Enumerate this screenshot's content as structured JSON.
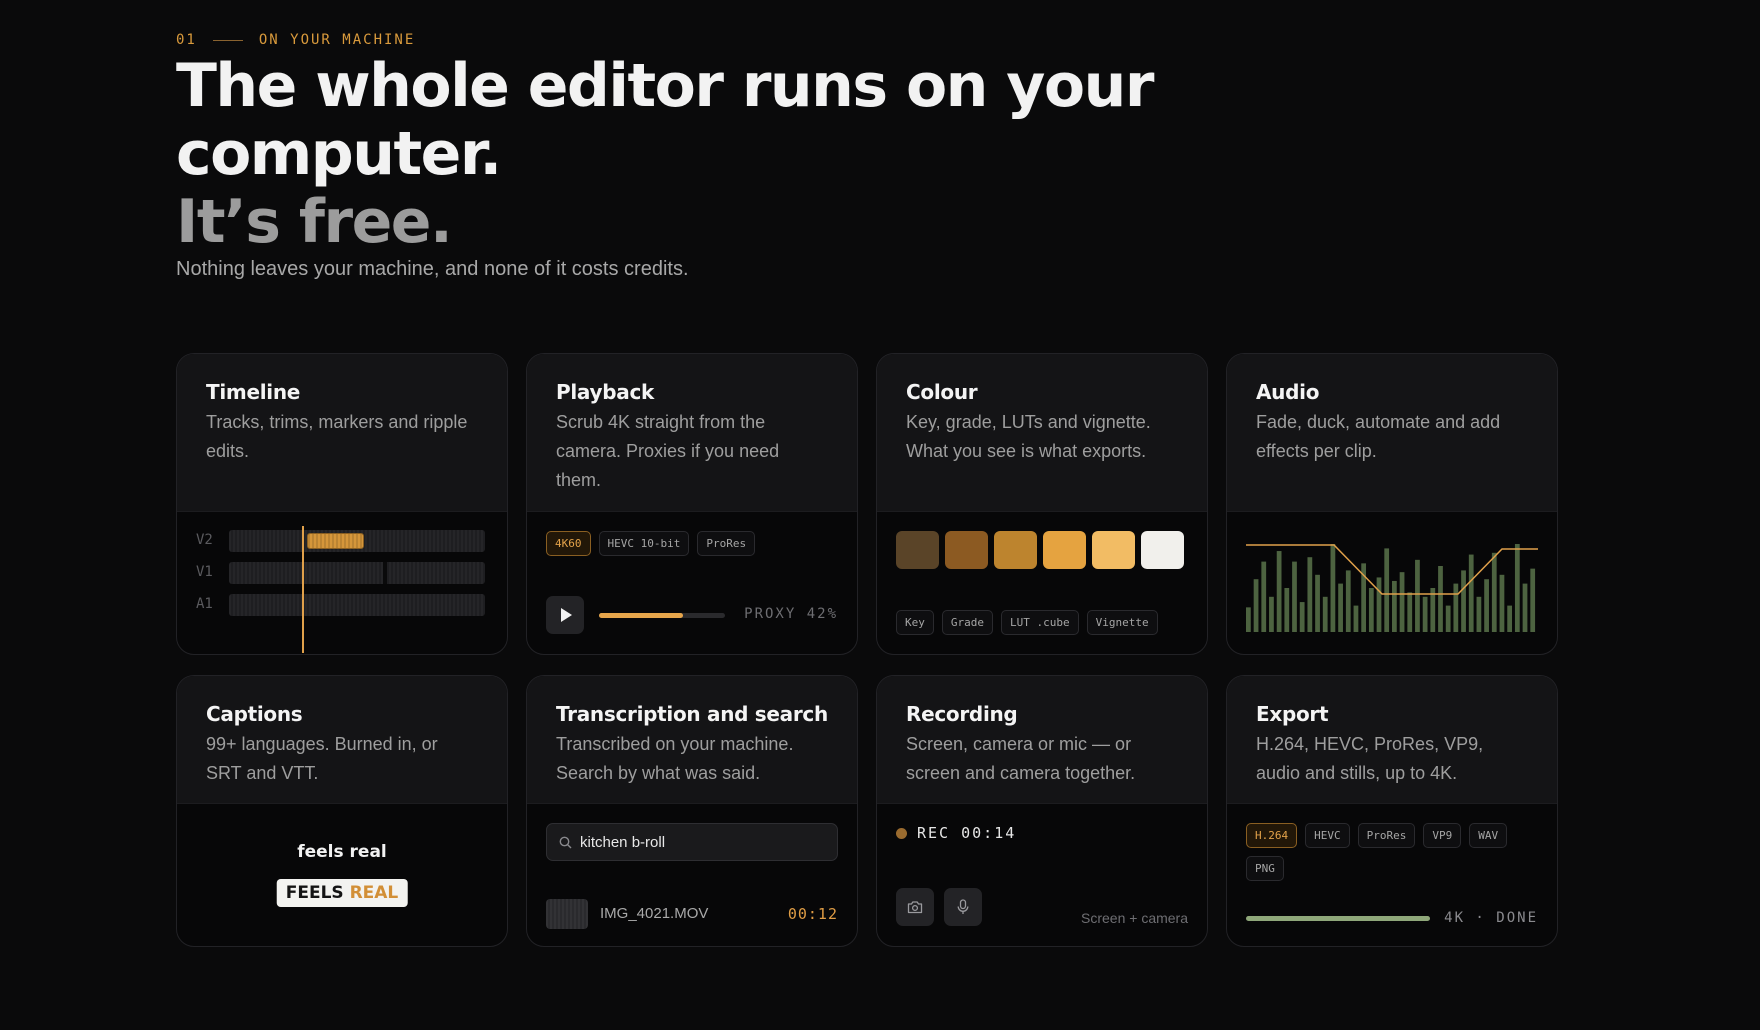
{
  "header": {
    "eyebrow_num": "01",
    "eyebrow_text": "ON YOUR MACHINE",
    "headline": "The whole editor runs on your computer.",
    "headline_free": "It’s free.",
    "subhead": "Nothing leaves your machine, and none of it costs credits."
  },
  "cards": {
    "timeline": {
      "title": "Timeline",
      "desc": "Tracks, trims, markers and ripple edits.",
      "tracks": [
        "V2",
        "V1",
        "A1"
      ]
    },
    "playback": {
      "title": "Playback",
      "desc": "Scrub 4K straight from the camera. Proxies if you need them.",
      "chips": [
        "4K60",
        "HEVC 10-bit",
        "ProRes"
      ],
      "active_chip": "4K60",
      "proxy_label": "PROXY 42%",
      "progress": 0.67
    },
    "colour": {
      "title": "Colour",
      "desc": "Key, grade, LUTs and vignette. What you see is what exports.",
      "swatches": [
        "#5a4428",
        "#8c5a22",
        "#bd842e",
        "#e5a340",
        "#f2bc64",
        "#f1f0ec"
      ],
      "chips": [
        "Key",
        "Grade",
        "LUT .cube",
        "Vignette"
      ]
    },
    "audio": {
      "title": "Audio",
      "desc": "Fade, duck, automate and add effects per clip.",
      "bar_levels": [
        0.28,
        0.6,
        0.8,
        0.4,
        0.92,
        0.5,
        0.8,
        0.34,
        0.85,
        0.65,
        0.4,
        1.0,
        0.55,
        0.7,
        0.3,
        0.78,
        0.5,
        0.62,
        0.95,
        0.58,
        0.68,
        0.45,
        0.82,
        0.4,
        0.5,
        0.75,
        0.3,
        0.55,
        0.7,
        0.88,
        0.4,
        0.6,
        0.9,
        0.65,
        0.3,
        1.0,
        0.55,
        0.72
      ],
      "waveform_color": "#4d6340",
      "envelope_color": "#e0a04a"
    },
    "captions": {
      "title": "Captions",
      "desc": "99+ languages. Burned in, or SRT and VTT.",
      "line1": "feels real",
      "word1": "FEELS",
      "word2": "REAL"
    },
    "transcription": {
      "title": "Transcription and search",
      "desc": "Transcribed on your machine. Search by what was said.",
      "search_value": "kitchen b-roll",
      "result_file": "IMG_4021.MOV",
      "result_time": "00:12"
    },
    "recording": {
      "title": "Recording",
      "desc": "Screen, camera or mic — or screen and camera together.",
      "rec_label": "REC 00:14",
      "mode": "Screen + camera"
    },
    "export": {
      "title": "Export",
      "desc": "H.264, HEVC, ProRes, VP9, audio and stills, up to 4K.",
      "chips": [
        "H.264",
        "HEVC",
        "ProRes",
        "VP9",
        "WAV",
        "PNG"
      ],
      "active_chip": "H.264",
      "status": "4K · DONE",
      "progress": 1.0
    }
  },
  "colors": {
    "accent": "#e0a04a",
    "background": "#0a0a0b",
    "done_green": "#8fa77a"
  }
}
